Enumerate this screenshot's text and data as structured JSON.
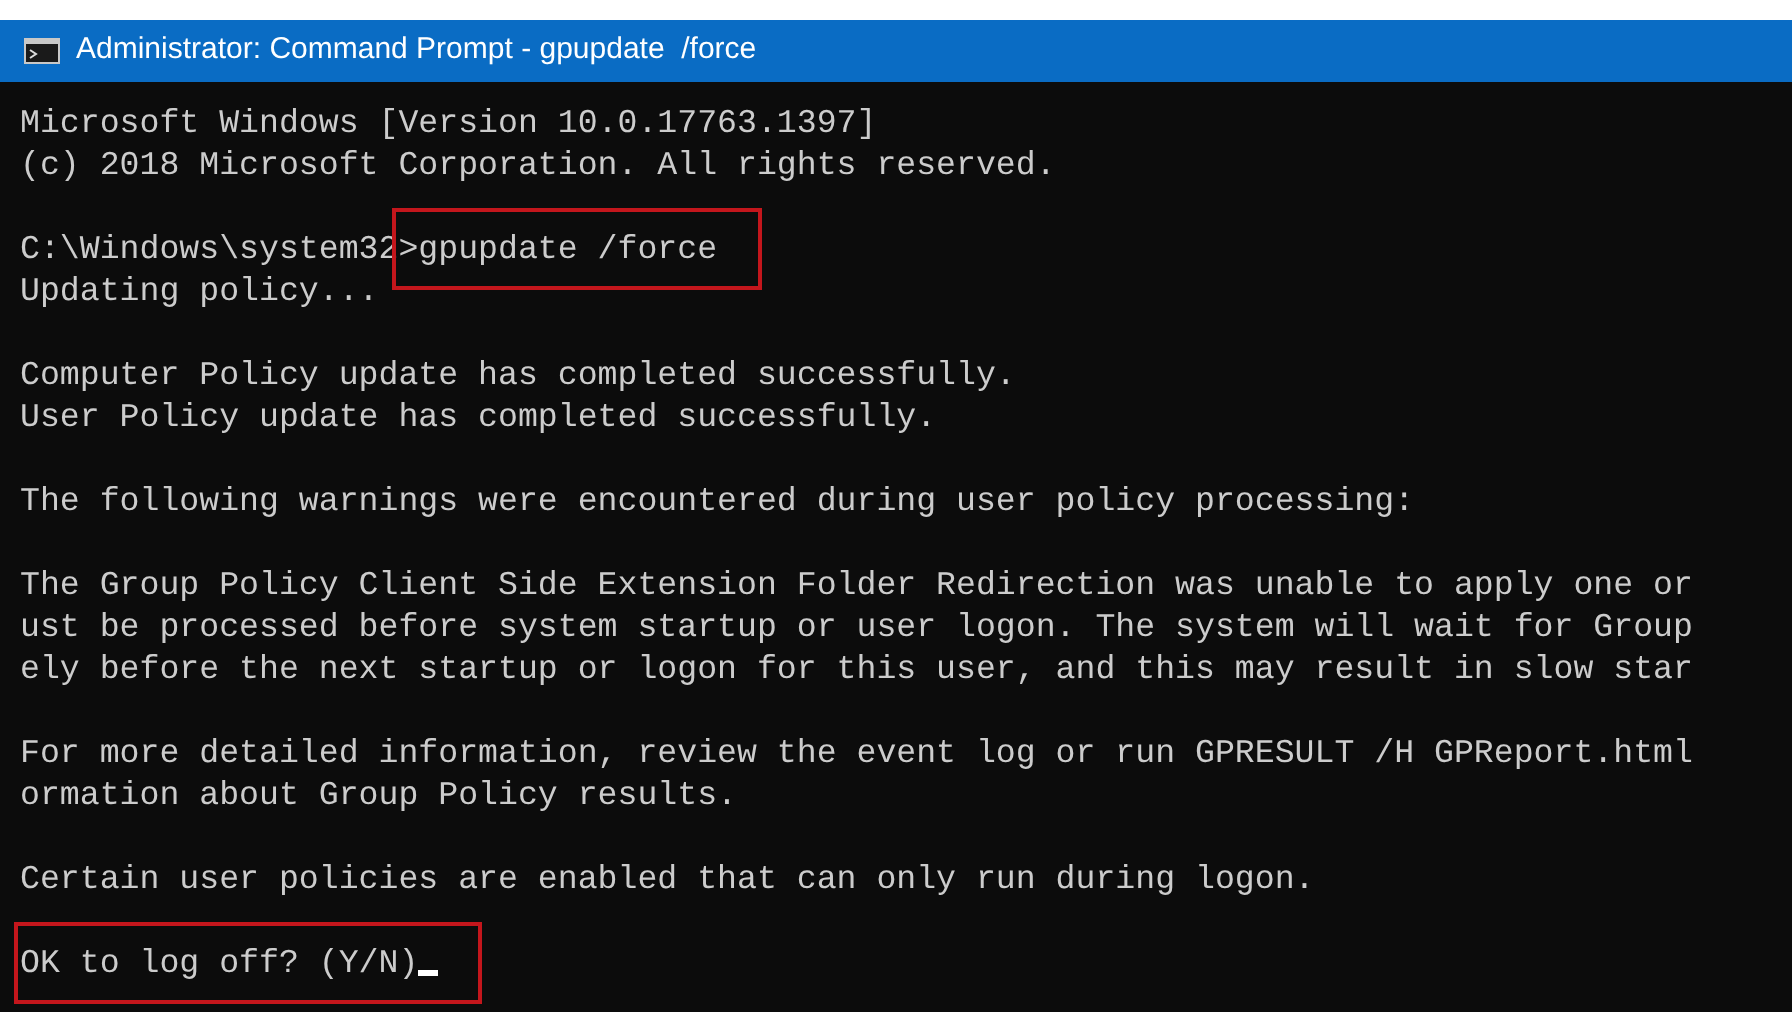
{
  "window": {
    "title": "Administrator: Command Prompt - gpupdate  /force"
  },
  "blocks": [
    {
      "lines": [
        {
          "segments": [
            {
              "text": "Microsoft Windows [Version 10.0.17763.1397]",
              "highlighted": false
            }
          ]
        },
        {
          "segments": [
            {
              "text": "(c) 2018 Microsoft Corporation. All rights reserved.",
              "highlighted": false
            }
          ]
        }
      ]
    },
    {
      "lines": [
        {
          "segments": [
            {
              "text": "C:\\Windows\\system32",
              "highlighted": false
            },
            {
              "text": ">gpupdate /force",
              "highlighted": true
            }
          ]
        },
        {
          "segments": [
            {
              "text": "Updating policy...",
              "highlighted": false
            }
          ]
        }
      ]
    },
    {
      "lines": [
        {
          "segments": [
            {
              "text": "Computer Policy update has completed successfully.",
              "highlighted": false
            }
          ]
        },
        {
          "segments": [
            {
              "text": "User Policy update has completed successfully.",
              "highlighted": false
            }
          ]
        }
      ]
    },
    {
      "lines": [
        {
          "segments": [
            {
              "text": "The following warnings were encountered during user policy processing:",
              "highlighted": false
            }
          ]
        }
      ]
    },
    {
      "lines": [
        {
          "segments": [
            {
              "text": "The Group Policy Client Side Extension Folder Redirection was unable to apply one or",
              "highlighted": false
            }
          ]
        },
        {
          "segments": [
            {
              "text": "ust be processed before system startup or user logon. The system will wait for Group",
              "highlighted": false
            }
          ]
        },
        {
          "segments": [
            {
              "text": "ely before the next startup or logon for this user, and this may result in slow star",
              "highlighted": false
            }
          ]
        }
      ]
    },
    {
      "lines": [
        {
          "segments": [
            {
              "text": "For more detailed information, review the event log or run GPRESULT /H GPReport.html",
              "highlighted": false
            }
          ]
        },
        {
          "segments": [
            {
              "text": "ormation about Group Policy results.",
              "highlighted": false
            }
          ]
        }
      ]
    },
    {
      "lines": [
        {
          "segments": [
            {
              "text": "Certain user policies are enabled that can only run during logon.",
              "highlighted": false
            }
          ]
        }
      ]
    },
    {
      "lines": [
        {
          "segments": [
            {
              "text": "OK to log off? (Y/N)",
              "highlighted": true
            }
          ],
          "cursor": true
        }
      ]
    }
  ]
}
